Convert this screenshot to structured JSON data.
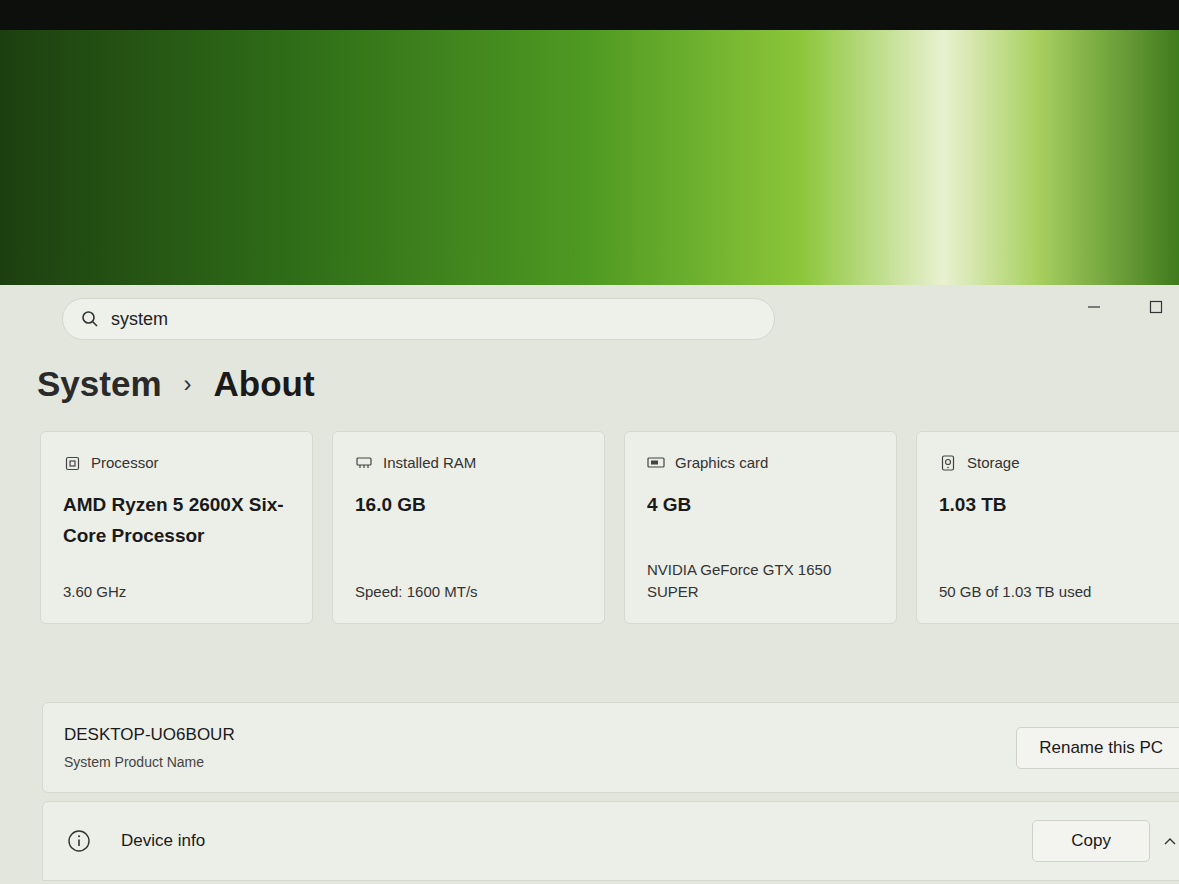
{
  "search": {
    "value": "system"
  },
  "breadcrumb": {
    "parent": "System",
    "separator": "›",
    "current": "About"
  },
  "specs": [
    {
      "kind": "processor",
      "label": "Processor",
      "value": "AMD Ryzen 5 2600X Six-Core Processor",
      "detail": "3.60 GHz"
    },
    {
      "kind": "ram",
      "label": "Installed RAM",
      "value": "16.0 GB",
      "detail": "Speed: 1600 MT/s"
    },
    {
      "kind": "gpu",
      "label": "Graphics card",
      "value": "4 GB",
      "detail": "NVIDIA GeForce GTX 1650 SUPER"
    },
    {
      "kind": "storage",
      "label": "Storage",
      "value": "1.03 TB",
      "detail": "50 GB of 1.03 TB used"
    }
  ],
  "device": {
    "name": "DESKTOP-UO6BOUR",
    "label": "System Product Name",
    "button": "Rename this PC"
  },
  "device_info": {
    "label": "Device info",
    "button": "Copy"
  }
}
